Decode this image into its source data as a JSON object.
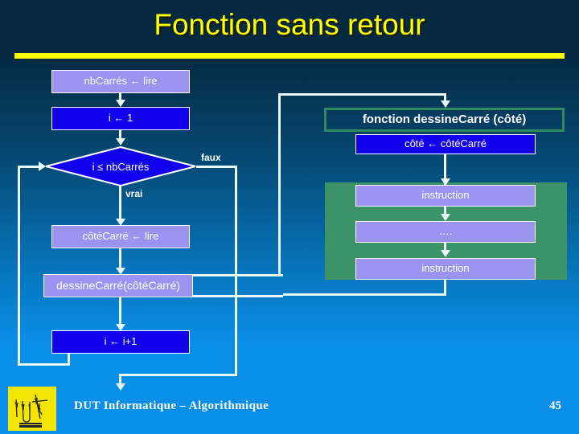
{
  "slide": {
    "title": "Fonction sans retour",
    "accent_color": "#ffff00",
    "background_top": "#052941",
    "background_bottom": "#0a8fe8"
  },
  "main_flow": {
    "nodes": [
      {
        "id": "read_nb",
        "label": "nbCarrés ← lire",
        "shape": "process",
        "fill": "#9a93f0"
      },
      {
        "id": "init_i",
        "label": "i ← 1",
        "shape": "process",
        "fill": "#1100ee"
      },
      {
        "id": "cond",
        "label": "i ≤ nbCarrés",
        "shape": "decision",
        "fill": "#1100ee"
      },
      {
        "id": "read_cote",
        "label": "côtéCarré ← lire",
        "shape": "process",
        "fill": "#9a93f0"
      },
      {
        "id": "call_dessine",
        "label": "dessineCarré(côtéCarré)",
        "shape": "subprogram",
        "fill": "#9a93f0"
      },
      {
        "id": "inc_i",
        "label": "i ← i+1",
        "shape": "process",
        "fill": "#1100ee"
      }
    ],
    "branch_labels": {
      "true": "vrai",
      "false": "faux"
    }
  },
  "function_panel": {
    "header": "fonction dessineCarré (côté)",
    "header_border_color": "#2e8b60",
    "param_assign": "côté ← côtéCarré",
    "body_background": "#3b9367",
    "body_steps": [
      {
        "label": "instruction"
      },
      {
        "label": "…."
      },
      {
        "label": "instruction"
      }
    ]
  },
  "footer": {
    "logo_name": "iut-logo",
    "text": "DUT Informatique – Algorithmique",
    "page_number": "45"
  }
}
